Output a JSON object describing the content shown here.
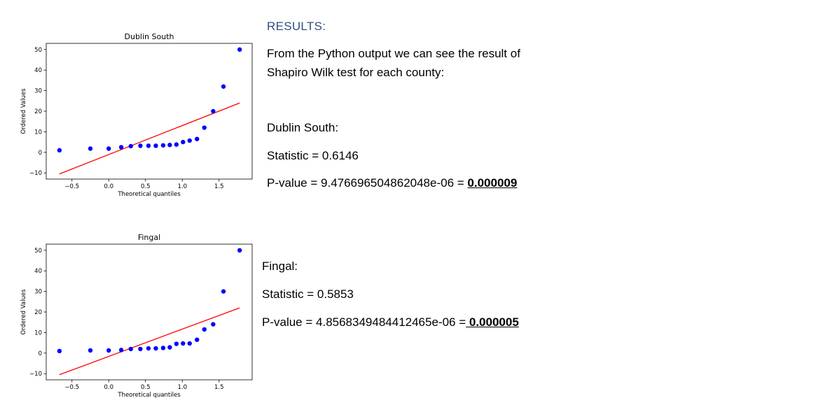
{
  "chart_data": [
    {
      "type": "scatter",
      "title": "Dublin South",
      "xlabel": "Theoretical quantiles",
      "ylabel": "Ordered Values",
      "xlim": [
        -0.85,
        1.95
      ],
      "ylim": [
        -13,
        53
      ],
      "xticks": [
        -0.5,
        0.0,
        0.5,
        1.0,
        1.5
      ],
      "xtick_labels": [
        "−0.5",
        "0.0",
        "0.5",
        "1.0",
        "1.5"
      ],
      "yticks": [
        -10,
        0,
        10,
        20,
        30,
        40,
        50
      ],
      "ytick_labels": [
        "−10",
        "0",
        "10",
        "20",
        "30",
        "40",
        "50"
      ],
      "point_color": "#0000ff",
      "line_color": "#ff0000",
      "points": [
        [
          -0.67,
          1.0
        ],
        [
          -0.25,
          1.8
        ],
        [
          0.0,
          1.8
        ],
        [
          0.17,
          2.5
        ],
        [
          0.3,
          3.0
        ],
        [
          0.43,
          3.2
        ],
        [
          0.54,
          3.2
        ],
        [
          0.64,
          3.2
        ],
        [
          0.74,
          3.4
        ],
        [
          0.83,
          3.6
        ],
        [
          0.92,
          3.8
        ],
        [
          1.01,
          5.0
        ],
        [
          1.1,
          5.7
        ],
        [
          1.2,
          6.5
        ],
        [
          1.3,
          12.0
        ],
        [
          1.42,
          20.0
        ],
        [
          1.56,
          32.0
        ],
        [
          1.78,
          50.0
        ]
      ],
      "fit_line": [
        [
          -0.67,
          -10.5
        ],
        [
          1.78,
          24.0
        ]
      ]
    },
    {
      "type": "scatter",
      "title": "Fingal",
      "xlabel": "Theoretical quantiles",
      "ylabel": "Ordered Values",
      "xlim": [
        -0.85,
        1.95
      ],
      "ylim": [
        -13,
        53
      ],
      "xticks": [
        -0.5,
        0.0,
        0.5,
        1.0,
        1.5
      ],
      "xtick_labels": [
        "−0.5",
        "0.0",
        "0.5",
        "1.0",
        "1.5"
      ],
      "yticks": [
        -10,
        0,
        10,
        20,
        30,
        40,
        50
      ],
      "ytick_labels": [
        "−10",
        "0",
        "10",
        "20",
        "30",
        "40",
        "50"
      ],
      "point_color": "#0000ff",
      "line_color": "#ff0000",
      "points": [
        [
          -0.67,
          1.0
        ],
        [
          -0.25,
          1.3
        ],
        [
          0.0,
          1.3
        ],
        [
          0.17,
          1.5
        ],
        [
          0.3,
          2.0
        ],
        [
          0.43,
          2.0
        ],
        [
          0.54,
          2.3
        ],
        [
          0.64,
          2.3
        ],
        [
          0.74,
          2.5
        ],
        [
          0.83,
          2.8
        ],
        [
          0.92,
          4.5
        ],
        [
          1.01,
          4.7
        ],
        [
          1.1,
          4.7
        ],
        [
          1.2,
          6.5
        ],
        [
          1.3,
          11.5
        ],
        [
          1.42,
          14.0
        ],
        [
          1.56,
          30.0
        ],
        [
          1.78,
          50.0
        ]
      ],
      "fit_line": [
        [
          -0.67,
          -10.5
        ],
        [
          1.78,
          22.0
        ]
      ]
    }
  ],
  "results": {
    "heading": "RESULTS:",
    "intro": "From the Python output we can see the result of Shapiro Wilk test for each county:",
    "dublin": {
      "name": "Dublin South:",
      "statistic": "Statistic = 0.6146",
      "pvalue_prefix": "P-value = 9.476696504862048e-06 = ",
      "pvalue_rounded": "0.000009"
    },
    "fingal": {
      "name": "Fingal:",
      "statistic": "Statistic = 0.5853",
      "pvalue_prefix": "P-value = 4.8568349484412465e-06 =",
      "pvalue_rounded": " 0.000005"
    }
  }
}
